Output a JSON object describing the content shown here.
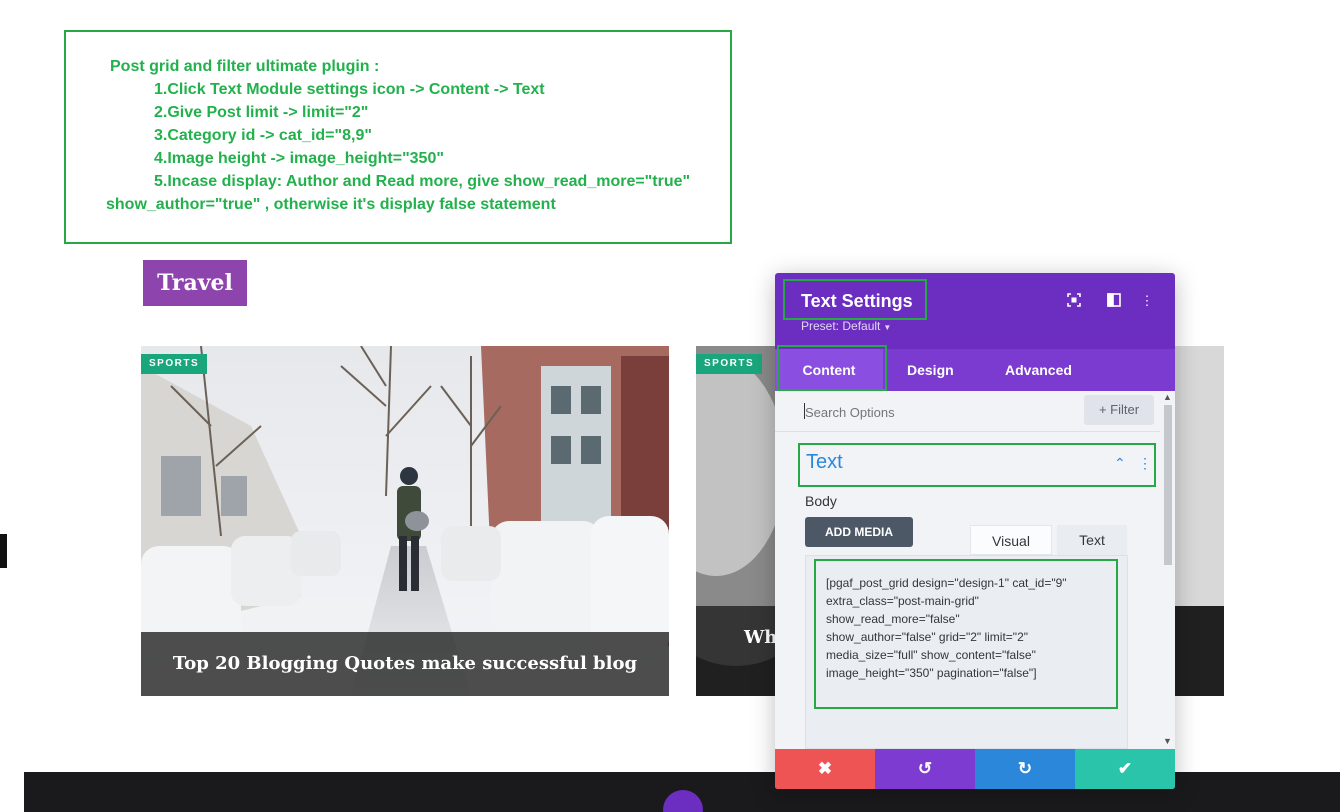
{
  "instructions": {
    "heading": "Post grid and filter ultimate plugin :",
    "step1": "1.Click Text Module settings icon -> Content -> Text",
    "step2": "2.Give Post limit -> limit=\"2\"",
    "step3": "3.Category id -> cat_id=\"8,9\"",
    "step4": "4.Image height -> image_height=\"350\"",
    "step5a": "5.Incase display: Author and Read more, give show_read_more=\"true\"",
    "step5b": "show_author=\"true\" , otherwise it's display false statement"
  },
  "section_heading": "Travel",
  "posts": [
    {
      "category": "SPORTS",
      "title": "Top 20 Blogging Quotes make successful blog"
    },
    {
      "category": "SPORTS",
      "title": "Wh"
    }
  ],
  "settings_modal": {
    "title": "Text Settings",
    "preset": "Preset: Default",
    "header_icons": [
      "focus-icon",
      "split-view-icon",
      "more-options-icon"
    ],
    "tabs": [
      "Content",
      "Design",
      "Advanced"
    ],
    "active_tab": "Content",
    "search_placeholder": "Search Options",
    "filter_label": "+ Filter",
    "section_title": "Text",
    "body_label": "Body",
    "add_media_label": "ADD MEDIA",
    "editor_tabs": [
      "Visual",
      "Text"
    ],
    "shortcode": "[pgaf_post_grid design=\"design-1\" cat_id=\"9\"\nextra_class=\"post-main-grid\"\nshow_read_more=\"false\"\nshow_author=\"false\" grid=\"2\" limit=\"2\"\nmedia_size=\"full\" show_content=\"false\"\nimage_height=\"350\" pagination=\"false\"]",
    "footer_buttons": [
      {
        "icon": "close-icon",
        "glyph": "✖",
        "color": "#ef5454"
      },
      {
        "icon": "undo-icon",
        "glyph": "↺",
        "color": "#7d3bd1"
      },
      {
        "icon": "redo-icon",
        "glyph": "↻",
        "color": "#2b87da"
      },
      {
        "icon": "check-icon",
        "glyph": "✔",
        "color": "#29c4a9"
      }
    ]
  },
  "colors": {
    "accent_green": "#23b14d",
    "purple": "#6c2ec1",
    "travel_purple": "#8e44ad",
    "badge_green": "#1aa67d"
  }
}
